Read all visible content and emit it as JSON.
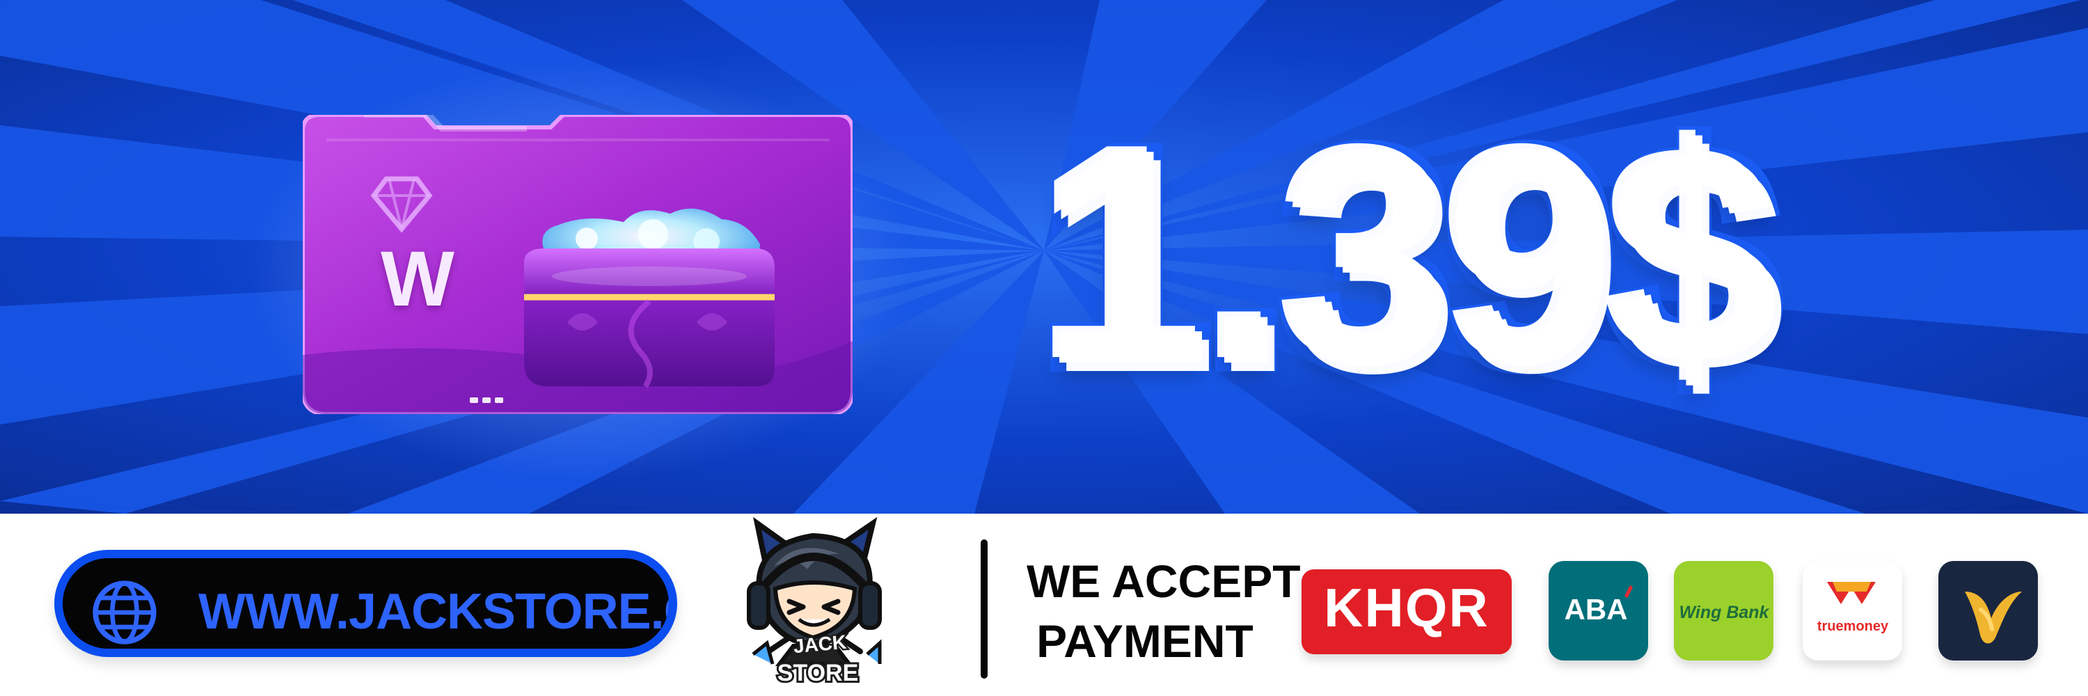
{
  "hero": {
    "price": "1.39$",
    "product_letter": "W"
  },
  "footer": {
    "website": "WWW.JACKSTORE.COM",
    "mascot_text_line_1": "JACK",
    "mascot_text_line_2": "STORE",
    "payment_line_1": "WE ACCEPT",
    "payment_line_2": "PAYMENT"
  },
  "payment_methods": [
    {
      "name": "KHQR",
      "label": "KHQR"
    },
    {
      "name": "ABA",
      "label": "ABA"
    },
    {
      "name": "Wing Bank",
      "label": "Wing Bank"
    },
    {
      "name": "truemoney",
      "label": "truemoney"
    },
    {
      "name": "bird-logo",
      "label": ""
    }
  ],
  "colors": {
    "hero_blue": "#0b35b8",
    "ray_blue": "#1550df",
    "accent_blue": "#1b5cf5",
    "card_purple": "#b536d9",
    "khqr_red": "#e21f26",
    "aba_teal": "#006f7a",
    "wing_green": "#9bd12b",
    "dark_navy": "#19263f"
  },
  "icons": {
    "globe": "globe-icon",
    "diamond": "diamond-icon",
    "chest": "treasure-chest-icon",
    "mascot": "mascot-avatar-icon"
  }
}
